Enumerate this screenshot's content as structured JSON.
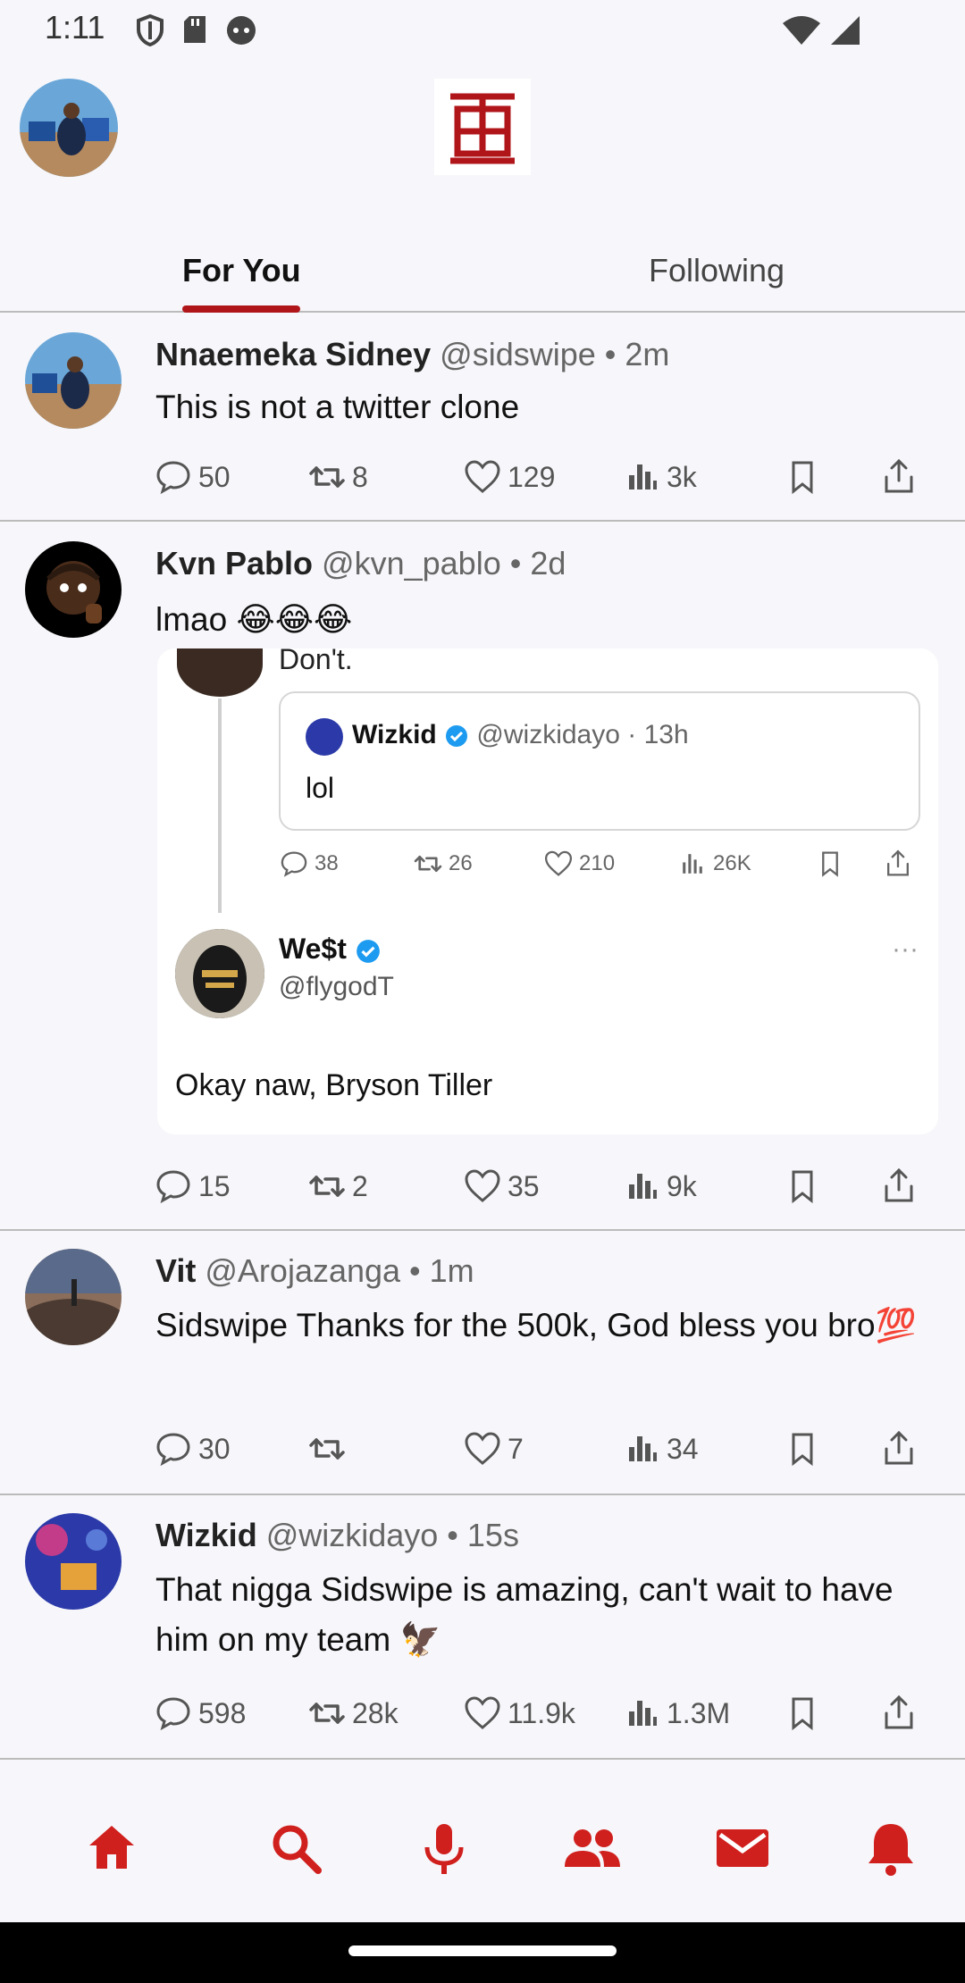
{
  "status": {
    "time": "1:11"
  },
  "tabs": {
    "for_you": "For You",
    "following": "Following"
  },
  "posts": [
    {
      "name": "Nnaemeka Sidney",
      "handle": "@sidswipe • 2m",
      "text": "This is not a twitter clone",
      "comments": "50",
      "retweets": "8",
      "likes": "129",
      "views": "3k"
    },
    {
      "name": "Kvn Pablo",
      "handle": "@kvn_pablo • 2d",
      "text": "lmao 😂😂😂",
      "comments": "15",
      "retweets": "2",
      "likes": "35",
      "views": "9k"
    },
    {
      "name": "Vit",
      "handle": "@Arojazanga • 1m",
      "text": "Sidswipe Thanks for the 500k, God bless you bro💯",
      "comments": "30",
      "retweets": "",
      "likes": "7",
      "views": "34"
    },
    {
      "name": "Wizkid",
      "handle": "@wizkidayo • 15s",
      "text": "That nigga Sidswipe is amazing, can't wait to have him on my team 🦅",
      "comments": "598",
      "retweets": "28k",
      "likes": "11.9k",
      "views": "1.3M"
    }
  ],
  "embed": {
    "dont": "Don't.",
    "quote_name": "Wizkid",
    "quote_handle": "@wizkidayo · 13h",
    "quote_text": "lol",
    "comments": "38",
    "retweets": "26",
    "likes": "210",
    "views": "26K",
    "west_name": "We$t",
    "west_handle": "@flygodT",
    "west_dots": "···",
    "west_text": "Okay naw, Bryson Tiller"
  },
  "colors": {
    "accent": "#b0151a",
    "nav_icon": "#d0201e",
    "verified": "#1d9bf0"
  }
}
